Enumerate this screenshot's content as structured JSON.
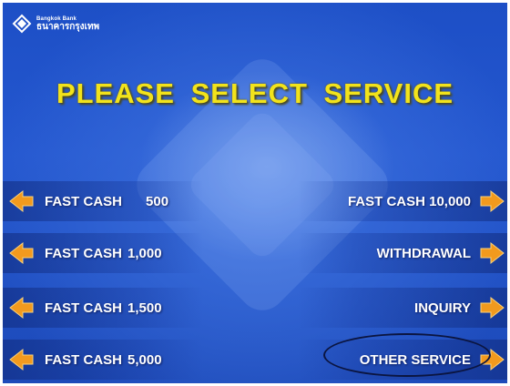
{
  "bank": {
    "name_en": "Bangkok Bank",
    "name_th": "ธนาคารกรุงเทพ"
  },
  "title": "PLEASE SELECT SERVICE",
  "left_buttons": [
    {
      "label": "FAST CASH",
      "amount": "500"
    },
    {
      "label": "FAST CASH",
      "amount": "1,000"
    },
    {
      "label": "FAST CASH",
      "amount": "1,500"
    },
    {
      "label": "FAST CASH",
      "amount": "5,000"
    }
  ],
  "right_buttons": [
    {
      "label": "FAST CASH 10,000"
    },
    {
      "label": "WITHDRAWAL"
    },
    {
      "label": "INQUIRY"
    },
    {
      "label": "OTHER SERVICE"
    }
  ],
  "colors": {
    "background": "#2457cf",
    "title": "#f2e31b",
    "arrow": "#f29a1e",
    "text": "#ffffff"
  },
  "icons": {
    "logo": "bangkok-bank-lotus-icon",
    "left_arrow": "orange-arrow-left-icon",
    "right_arrow": "orange-arrow-right-icon"
  }
}
